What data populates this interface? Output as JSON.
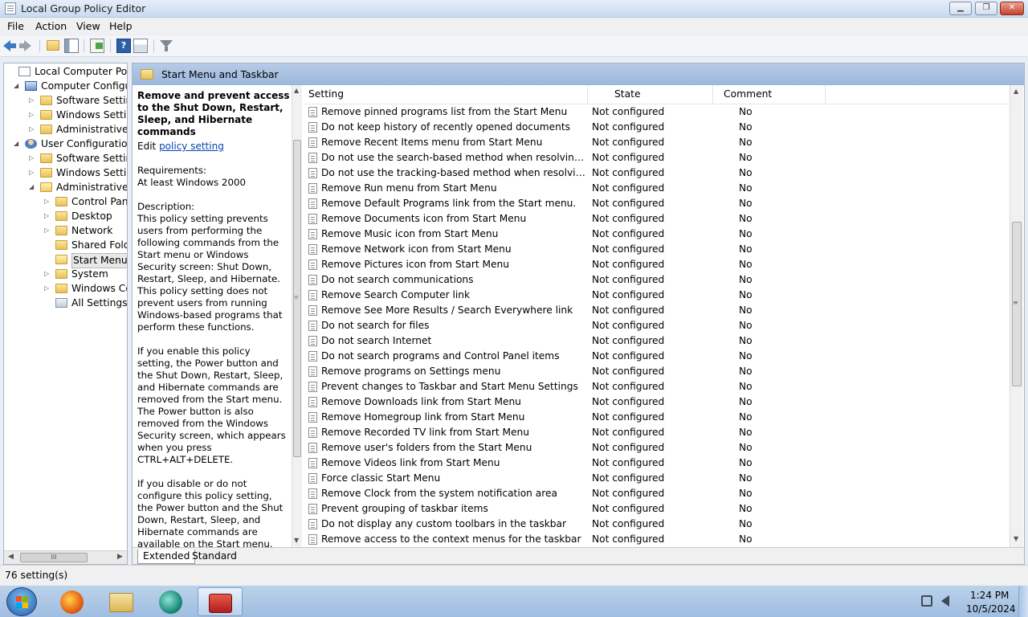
{
  "window": {
    "title": "Local Group Policy Editor",
    "caption_buttons": {
      "minimize": "▁",
      "maximize": "❐",
      "close": "✕"
    }
  },
  "menu": [
    "File",
    "Action",
    "View",
    "Help"
  ],
  "toolbar": {
    "icons": [
      "back-icon",
      "forward-icon",
      "up-folder-icon",
      "show-hide-console-tree-icon",
      "export-list-icon",
      "help-icon",
      "properties-icon",
      "filter-icon"
    ]
  },
  "tree": {
    "nodes": [
      {
        "label": "Local Computer Policy",
        "expander": "",
        "icon": "policy"
      },
      {
        "label": "Computer Configura",
        "expander": "◢",
        "icon": "computer"
      },
      {
        "label": "Software Settings",
        "expander": "▷",
        "icon": "folder"
      },
      {
        "label": "Windows Setting",
        "expander": "▷",
        "icon": "folder"
      },
      {
        "label": "Administrative Te",
        "expander": "▷",
        "icon": "folder"
      },
      {
        "label": "User Configuration",
        "expander": "◢",
        "icon": "user"
      },
      {
        "label": "Software Settings",
        "expander": "▷",
        "icon": "folder"
      },
      {
        "label": "Windows Setting",
        "expander": "▷",
        "icon": "folder"
      },
      {
        "label": "Administrative Te",
        "expander": "◢",
        "icon": "folder-open"
      },
      {
        "label": "Control Panel",
        "expander": "▷",
        "icon": "folder"
      },
      {
        "label": "Desktop",
        "expander": "▷",
        "icon": "folder"
      },
      {
        "label": "Network",
        "expander": "▷",
        "icon": "folder"
      },
      {
        "label": "Shared Folder",
        "expander": "",
        "icon": "folder"
      },
      {
        "label": "Start Menu ar",
        "expander": "",
        "icon": "folder-open",
        "selected": true
      },
      {
        "label": "System",
        "expander": "▷",
        "icon": "folder"
      },
      {
        "label": "Windows Cor",
        "expander": "▷",
        "icon": "folder"
      },
      {
        "label": "All Settings",
        "expander": "",
        "icon": "all-settings"
      }
    ],
    "hscroll_grip": "III"
  },
  "main": {
    "header": "Start Menu and Taskbar",
    "description": {
      "title": "Remove and prevent access to the Shut Down, Restart, Sleep, and Hibernate commands",
      "edit_prefix": "Edit ",
      "edit_link": "policy setting ",
      "body": "Requirements:\nAt least Windows 2000\n\nDescription:\nThis policy setting prevents users from performing the following commands from the Start menu or Windows Security screen: Shut Down, Restart, Sleep, and Hibernate. This policy setting does not prevent users from running Windows-based programs that perform these functions.\n\nIf you enable this policy setting, the Power button and the Shut Down, Restart, Sleep, and Hibernate commands are removed from the Start menu. The Power button is also removed from the Windows Security screen, which appears when you press CTRL+ALT+DELETE.\n\nIf you disable or do not configure this policy setting, the Power button and the Shut Down, Restart, Sleep, and Hibernate commands are available on the Start menu. The Power button on the Windows Security screen is also available."
    },
    "columns": {
      "setting": "Setting",
      "state": "State",
      "comment": "Comment"
    },
    "rows": [
      {
        "setting": "Remove pinned programs list from the Start Menu",
        "state": "Not configured",
        "comment": "No"
      },
      {
        "setting": "Do not keep history of recently opened documents",
        "state": "Not configured",
        "comment": "No"
      },
      {
        "setting": "Remove Recent Items menu from Start Menu",
        "state": "Not configured",
        "comment": "No"
      },
      {
        "setting": "Do not use the search-based method when resolving shell s...",
        "state": "Not configured",
        "comment": "No"
      },
      {
        "setting": "Do not use the tracking-based method when resolving shell ...",
        "state": "Not configured",
        "comment": "No"
      },
      {
        "setting": "Remove Run menu from Start Menu",
        "state": "Not configured",
        "comment": "No"
      },
      {
        "setting": "Remove Default Programs link from the Start menu.",
        "state": "Not configured",
        "comment": "No"
      },
      {
        "setting": "Remove Documents icon from Start Menu",
        "state": "Not configured",
        "comment": "No"
      },
      {
        "setting": "Remove Music icon from Start Menu",
        "state": "Not configured",
        "comment": "No"
      },
      {
        "setting": "Remove Network icon from Start Menu",
        "state": "Not configured",
        "comment": "No"
      },
      {
        "setting": "Remove Pictures icon from Start Menu",
        "state": "Not configured",
        "comment": "No"
      },
      {
        "setting": "Do not search communications",
        "state": "Not configured",
        "comment": "No"
      },
      {
        "setting": "Remove Search Computer link",
        "state": "Not configured",
        "comment": "No"
      },
      {
        "setting": "Remove See More Results / Search Everywhere link",
        "state": "Not configured",
        "comment": "No"
      },
      {
        "setting": "Do not search for files",
        "state": "Not configured",
        "comment": "No"
      },
      {
        "setting": "Do not search Internet",
        "state": "Not configured",
        "comment": "No"
      },
      {
        "setting": "Do not search programs and Control Panel items",
        "state": "Not configured",
        "comment": "No"
      },
      {
        "setting": "Remove programs on Settings menu",
        "state": "Not configured",
        "comment": "No"
      },
      {
        "setting": "Prevent changes to Taskbar and Start Menu Settings",
        "state": "Not configured",
        "comment": "No"
      },
      {
        "setting": "Remove Downloads link from Start Menu",
        "state": "Not configured",
        "comment": "No"
      },
      {
        "setting": "Remove Homegroup link from Start Menu",
        "state": "Not configured",
        "comment": "No"
      },
      {
        "setting": "Remove Recorded TV link from Start Menu",
        "state": "Not configured",
        "comment": "No"
      },
      {
        "setting": "Remove user's folders from the Start Menu",
        "state": "Not configured",
        "comment": "No"
      },
      {
        "setting": "Remove Videos link from Start Menu",
        "state": "Not configured",
        "comment": "No"
      },
      {
        "setting": "Force classic Start Menu",
        "state": "Not configured",
        "comment": "No"
      },
      {
        "setting": "Remove Clock from the system notification area",
        "state": "Not configured",
        "comment": "No"
      },
      {
        "setting": "Prevent grouping of taskbar items",
        "state": "Not configured",
        "comment": "No"
      },
      {
        "setting": "Do not display any custom toolbars in the taskbar",
        "state": "Not configured",
        "comment": "No"
      },
      {
        "setting": "Remove access to the context menus for the taskbar",
        "state": "Not configured",
        "comment": "No"
      }
    ],
    "tabs": [
      "Extended",
      "Standard"
    ],
    "scroll_glyphs": {
      "up": "▲",
      "down": "▼",
      "grip": "≡"
    }
  },
  "status": {
    "text": "76 setting(s)"
  },
  "taskbar": {
    "apps": [
      "firefox-icon",
      "file-explorer-icon",
      "browser-icon",
      "group-policy-editor-icon"
    ],
    "tray_icons": [
      "network-icon",
      "volume-icon"
    ],
    "time": "1:24 PM",
    "date": "10/5/2024"
  },
  "colors": {
    "title_bar": "#c9daf0",
    "header_bar": "#9cb7dc",
    "link": "#0645ad",
    "taskbar": "#9fbde0"
  }
}
